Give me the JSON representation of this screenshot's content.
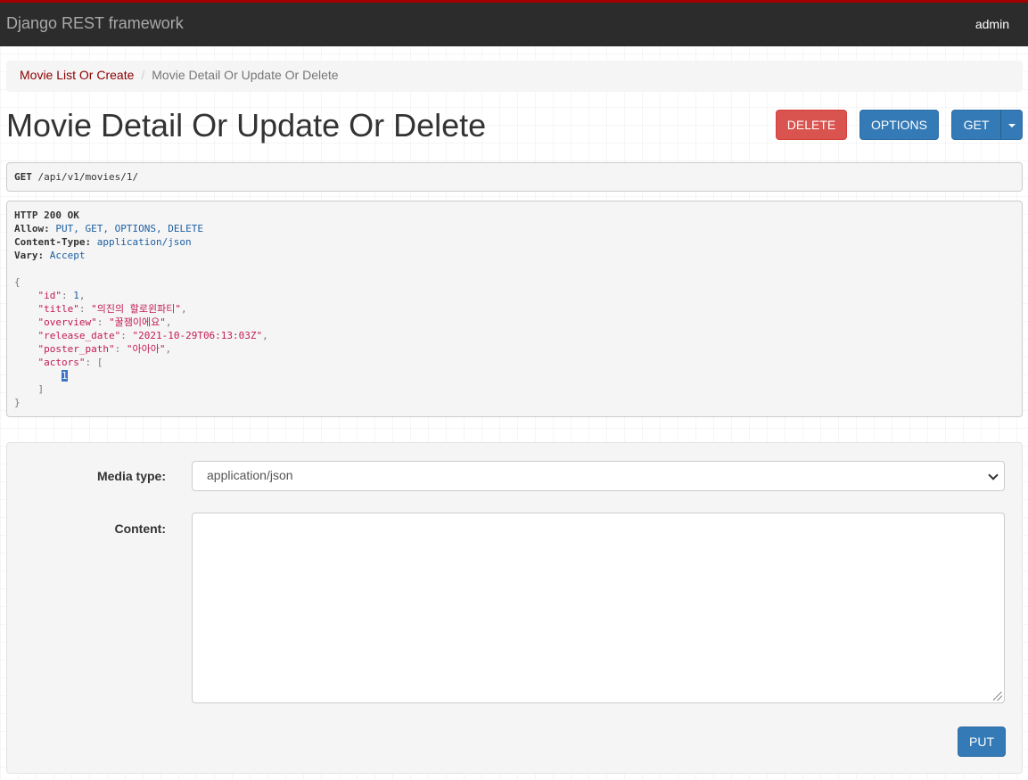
{
  "navbar": {
    "brand": "Django REST framework",
    "user": "admin"
  },
  "breadcrumb": {
    "items": [
      {
        "label": "Movie List Or Create"
      },
      {
        "label": "Movie Detail Or Update Or Delete"
      }
    ],
    "separator": "/"
  },
  "page": {
    "title": "Movie Detail Or Update Or Delete"
  },
  "actions": {
    "delete_label": "DELETE",
    "options_label": "OPTIONS",
    "get_label": "GET"
  },
  "request": {
    "method": "GET",
    "path": "/api/v1/movies/1/"
  },
  "response": {
    "status": "HTTP 200 OK",
    "headers": [
      {
        "name": "Allow:",
        "value": "PUT, GET, OPTIONS, DELETE"
      },
      {
        "name": "Content-Type:",
        "value": "application/json"
      },
      {
        "name": "Vary:",
        "value": "Accept"
      }
    ],
    "body": {
      "id_key": "\"id\"",
      "id_val": "1",
      "title_key": "\"title\"",
      "title_val": "\"의진의 할로윈파티\"",
      "overview_key": "\"overview\"",
      "overview_val": "\"꿀잼이에요\"",
      "release_date_key": "\"release_date\"",
      "release_date_val": "\"2021-10-29T06:13:03Z\"",
      "poster_path_key": "\"poster_path\"",
      "poster_path_val": "\"아아아\"",
      "actors_key": "\"actors\"",
      "actors_item": "1"
    }
  },
  "form": {
    "media_type_label": "Media type:",
    "media_type_value": "application/json",
    "content_label": "Content:",
    "content_value": "",
    "submit_label": "PUT"
  },
  "colors": {
    "navbar_bg": "#2c2c2c",
    "navbar_accent": "#a30000",
    "primary": "#337ab7",
    "danger": "#d9534f",
    "link": "#8c0000"
  }
}
